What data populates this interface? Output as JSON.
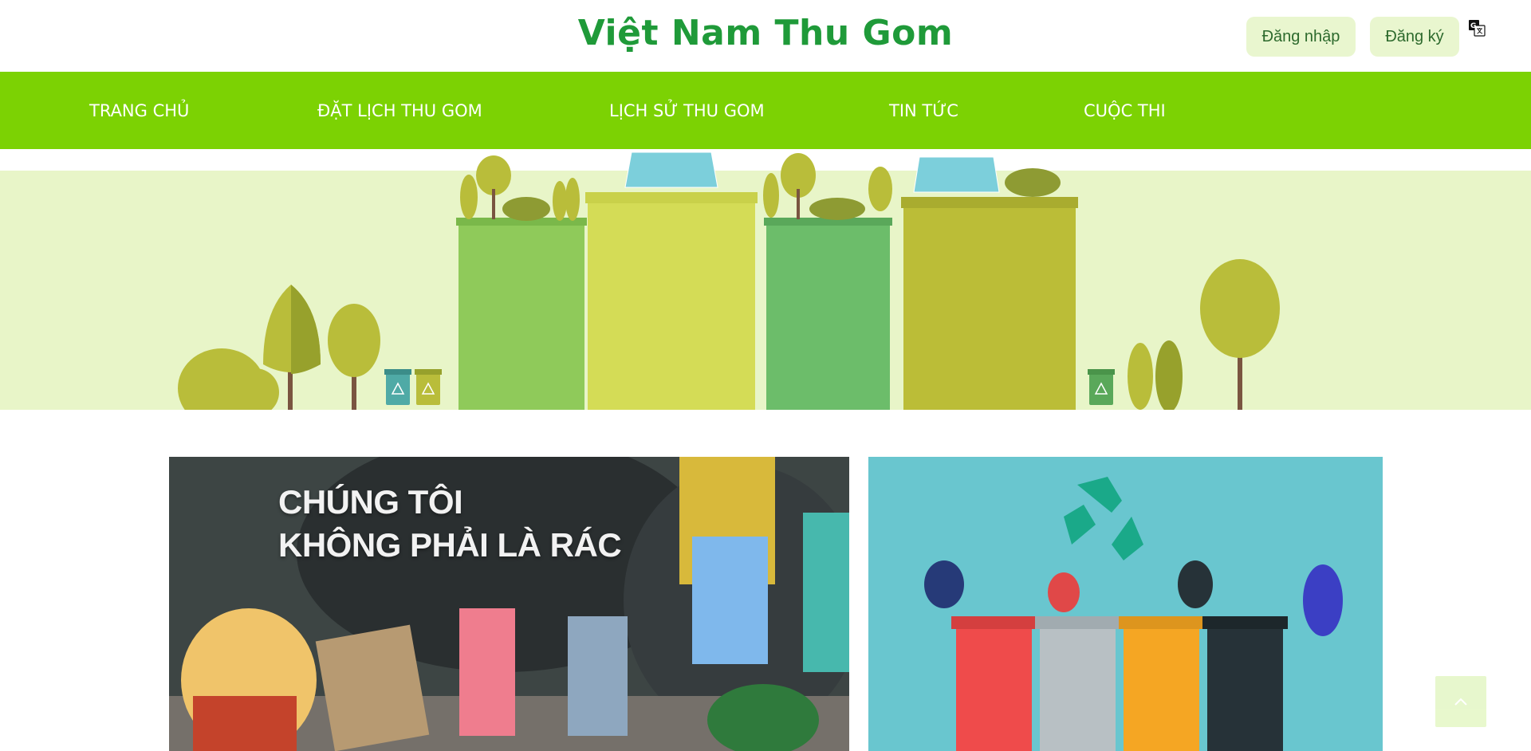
{
  "header": {
    "brand": "Việt Nam Thu Gom",
    "login_label": "Đăng nhập",
    "register_label": "Đăng ký",
    "translate_icon": "google-translate-icon"
  },
  "nav": {
    "items": [
      {
        "label": "TRANG CHỦ"
      },
      {
        "label": "ĐẶT LỊCH THU GOM"
      },
      {
        "label": "LỊCH SỬ THU GOM"
      },
      {
        "label": "TIN TỨC"
      },
      {
        "label": "CUỘC THI"
      }
    ]
  },
  "cards": [
    {
      "headline_line1": "CHÚNG TÔI",
      "headline_line2": "KHÔNG PHẢI LÀ RÁC"
    },
    {
      "headline_line1": "",
      "headline_line2": ""
    }
  ],
  "colors": {
    "brand": "#1f9a39",
    "nav_bg": "#7cd203",
    "auth_btn_bg": "#e9f6cf",
    "banner_bg": "#e8f5c8"
  },
  "icons": {
    "scroll_top": "chevron-up-icon"
  }
}
